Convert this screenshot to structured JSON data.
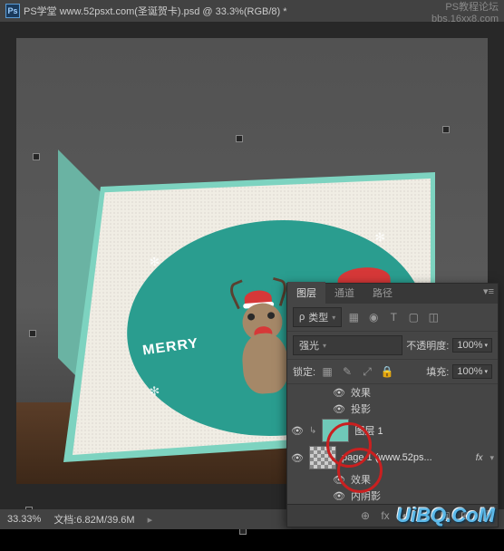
{
  "titlebar": {
    "title": "PS学堂  www.52psxt.com(圣诞贺卡).psd @ 33.3%(RGB/8) *"
  },
  "corner": {
    "line1": "PS教程论坛",
    "line2": "bbs.16xx8.com"
  },
  "card": {
    "merry_text": "MERRY"
  },
  "transform_handles": true,
  "panel": {
    "tabs": [
      "图层",
      "通道",
      "路径"
    ],
    "active_tab": 0,
    "filter": {
      "label": "类型",
      "icons": [
        "▦",
        "◉",
        "T",
        "▢",
        "◫"
      ]
    },
    "blend_mode": "强光",
    "opacity": {
      "label": "不透明度:",
      "value": "100%"
    },
    "lock": {
      "label": "锁定:",
      "icons": [
        "▦",
        "✎",
        "⤢",
        "🔒"
      ]
    },
    "fill": {
      "label": "填充:",
      "value": "100%"
    },
    "layers": [
      {
        "type": "effect-header",
        "visible": true,
        "name": "效果"
      },
      {
        "type": "effect",
        "visible": true,
        "name": "投影"
      },
      {
        "type": "layer",
        "visible": true,
        "thumb": "teal",
        "name": "图层 1",
        "clipped": true
      },
      {
        "type": "layer",
        "visible": true,
        "thumb": "checker",
        "name": "page 1 (www.52ps...",
        "fx": true
      },
      {
        "type": "effect-header",
        "visible": true,
        "name": "效果"
      },
      {
        "type": "effect",
        "visible": true,
        "name": "内阴影"
      }
    ],
    "footer_icons": [
      "⊕",
      "fx",
      "◐",
      "▢",
      "▣",
      "⊞",
      "🗑"
    ]
  },
  "statusbar": {
    "zoom": "33.33%",
    "doc": "文档:6.82M/39.6M"
  },
  "watermark": "UiBQ.CoM",
  "icons": {
    "ps": "Ps",
    "eye": "👁",
    "chev_down": "▾",
    "chev_right": "▸",
    "menu": "▾≡",
    "snowflake": "✻"
  }
}
